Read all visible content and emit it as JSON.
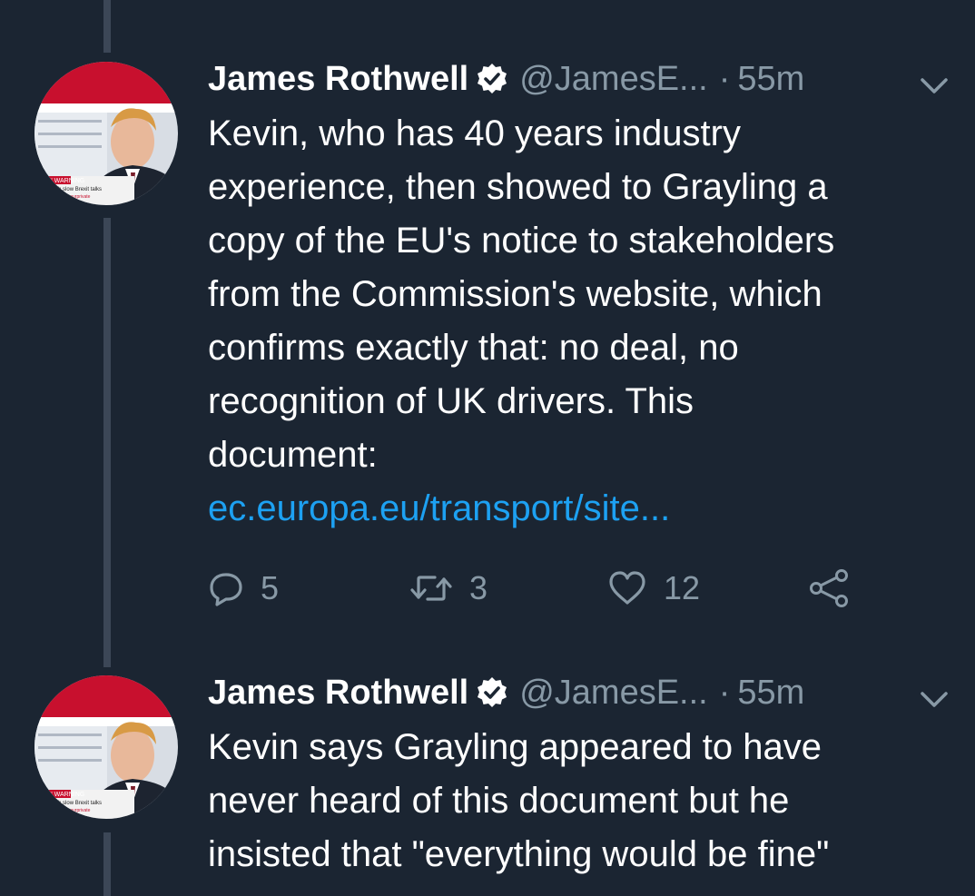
{
  "tweets": [
    {
      "name": "James Rothwell",
      "handle": "@JamesE...",
      "dot": "·",
      "time": "55m",
      "lines": [
        "Kevin, who has 40 years industry",
        "experience, then showed to Grayling a",
        "copy of the EU's notice to stakeholders",
        "from the Commission's website, which",
        "confirms exactly that: no deal, no",
        "recognition of UK drivers. This",
        "document:"
      ],
      "link": "ec.europa.eu/transport/site...",
      "replies": "5",
      "retweets": "3",
      "likes": "12",
      "avatar_caption": [
        "MAIL' WARNING",
        "ed up with slow Brexit talks",
        "RES & VIDEO: yourprivate"
      ]
    },
    {
      "name": "James Rothwell",
      "handle": "@JamesE...",
      "dot": "·",
      "time": "55m",
      "lines": [
        "Kevin says Grayling appeared to have",
        "never heard of this document but he",
        "insisted that \"everything would be fine\""
      ],
      "avatar_caption": [
        "MAIL' WARNING",
        "ed up with slow Brexit talks",
        "RES & VIDEO: yourprivate"
      ]
    }
  ],
  "icons": {
    "verified": "verified-badge-icon",
    "caret": "chevron-down-icon",
    "reply": "reply-icon",
    "retweet": "retweet-icon",
    "like": "heart-icon",
    "share": "share-icon"
  },
  "colors": {
    "background": "#1b2532",
    "thread_line": "#3c4757",
    "text": "#ffffff",
    "secondary": "#8899a6",
    "link": "#1da1f2"
  }
}
